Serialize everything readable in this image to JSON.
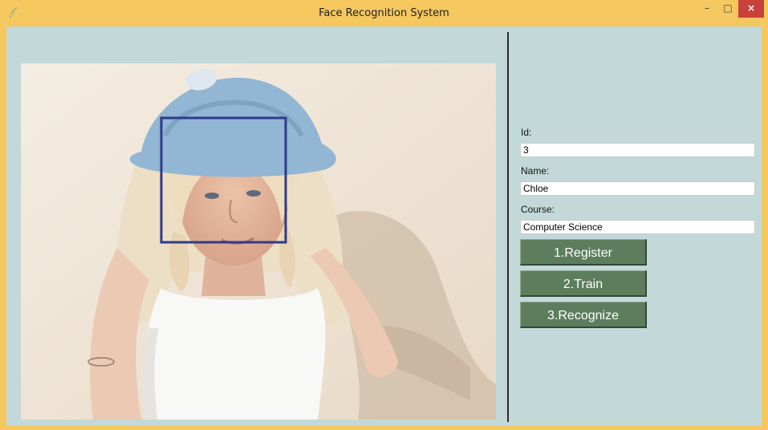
{
  "window": {
    "title": "Face Recognition System",
    "minimize_glyph": "–",
    "maximize_glyph": "□",
    "close_glyph": "×"
  },
  "photo": {
    "icon": "portrait-photo",
    "face_box_color": "#2f3a8a"
  },
  "form": {
    "id_label": "Id:",
    "id_value": "3",
    "name_label": "Name:",
    "name_value": "Chloe",
    "course_label": "Course:",
    "course_value": "Computer Science"
  },
  "buttons": {
    "register": "1.Register",
    "train": "2.Train",
    "recognize": "3.Recognize"
  },
  "colors": {
    "titlebar": "#f4c75f",
    "client_bg": "#c3d8d8",
    "button_bg": "#5d7e5d",
    "close_bg": "#c8413a"
  }
}
